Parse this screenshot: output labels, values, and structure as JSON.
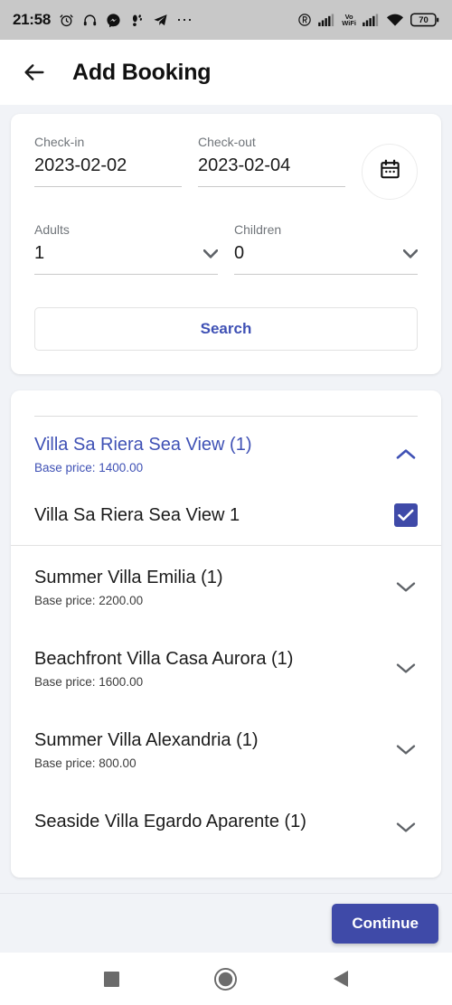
{
  "status_bar": {
    "time": "21:58",
    "left_icons": [
      "alarm-clock-icon",
      "headphones-icon",
      "messenger-icon",
      "footprint-icon",
      "telegram-icon",
      "more-dots-icon"
    ],
    "right_icons": [
      "dnd-r-icon",
      "signal-bars-1-icon",
      "volte-wifi-icon",
      "signal-bars-2-icon",
      "wifi-icon"
    ],
    "volte_label": "Vo",
    "wifi_label": "WiFi",
    "battery_level": "70"
  },
  "app_bar": {
    "back_icon": "arrow-left-icon",
    "title": "Add Booking"
  },
  "search_card": {
    "checkin": {
      "label": "Check-in",
      "value": "2023-02-02"
    },
    "checkout": {
      "label": "Check-out",
      "value": "2023-02-04"
    },
    "calendar_icon": "calendar-icon",
    "adults": {
      "label": "Adults",
      "value": "1"
    },
    "children": {
      "label": "Children",
      "value": "0"
    },
    "search_button": "Search"
  },
  "results": [
    {
      "title": "Villa Sa Riera Sea View (1)",
      "subtitle": "Base price: 1400.00",
      "expanded": true,
      "chevron": "chevron-up-icon",
      "units": [
        {
          "label": "Villa Sa Riera Sea View 1",
          "checked": true
        }
      ]
    },
    {
      "title": "Summer Villa Emilia (1)",
      "subtitle": "Base price: 2200.00",
      "expanded": false,
      "chevron": "chevron-down-icon",
      "units": []
    },
    {
      "title": "Beachfront Villa Casa Aurora (1)",
      "subtitle": "Base price: 1600.00",
      "expanded": false,
      "chevron": "chevron-down-icon",
      "units": []
    },
    {
      "title": "Summer Villa Alexandria (1)",
      "subtitle": "Base price: 800.00",
      "expanded": false,
      "chevron": "chevron-down-icon",
      "units": []
    },
    {
      "title": "Seaside Villa Egardo Aparente (1)",
      "subtitle": "",
      "expanded": false,
      "chevron": "chevron-down-icon",
      "units": []
    }
  ],
  "footer": {
    "continue_button": "Continue"
  },
  "nav_bar": {
    "recents_icon": "square-recents-icon",
    "home_icon": "circle-home-icon",
    "back_icon": "triangle-back-icon"
  },
  "colors": {
    "accent": "#3f4aa8",
    "link": "#3f51b5",
    "page_bg": "#f1f3f7",
    "card_bg": "#ffffff",
    "statusbar_bg": "#c8c8c8"
  }
}
